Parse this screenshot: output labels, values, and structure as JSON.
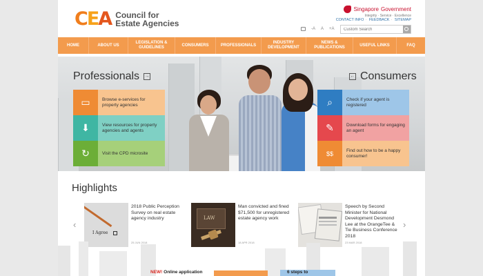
{
  "logo": {
    "mark": "CEA",
    "line1": "Council for",
    "line2": "Estate Agencies"
  },
  "gov": {
    "name_pre": "Singapore ",
    "name_post": "Government",
    "tagline": "Integrity · Service · Excellence"
  },
  "util_links": [
    "CONTACT INFO",
    "FEEDBACK",
    "SITEMAP"
  ],
  "text_size": [
    "-A",
    "A",
    "+A"
  ],
  "search": {
    "placeholder": "Custom Search"
  },
  "nav": [
    "HOME",
    "ABOUT US",
    "LEGISLATION & GUIDELINES",
    "CONSUMERS",
    "PROFESSIONALS",
    "INDUSTRY DEVELOPMENT",
    "NEWS & PUBLICATIONS",
    "USEFUL LINKS",
    "FAQ"
  ],
  "hero": {
    "professionals_title": "Professionals",
    "consumers_title": "Consumers",
    "professionals": [
      {
        "label": "Browse e-services for property agencies",
        "color": "#f8c48f",
        "icon_bg": "#ef8b34",
        "icon": "laptop-icon"
      },
      {
        "label": "View resources for property agencies and agents",
        "color": "#7fd0c4",
        "icon_bg": "#3fb6a3",
        "icon": "download-icon"
      },
      {
        "label": "Visit the CPD microsite",
        "color": "#a6d07a",
        "icon_bg": "#6cae37",
        "icon": "refresh-icon"
      }
    ],
    "consumers": [
      {
        "label": "Check if your agent is registered",
        "color": "#9ec6e8",
        "icon_bg": "#2f7dc2",
        "icon": "magnifier-icon"
      },
      {
        "label": "Download forms for engaging an agent",
        "color": "#f1a2a2",
        "icon_bg": "#e5484d",
        "icon": "form-icon"
      },
      {
        "label": "Find out how to be a happy consumer!",
        "color": "#f8c48f",
        "icon_bg": "#ef8b34",
        "icon": "handshake-icon"
      }
    ]
  },
  "highlights": {
    "title": "Highlights",
    "items": [
      {
        "title": "2018 Public Perception Survey on real estate agency industry",
        "date": "25 JUN 2018",
        "thumb_text": "I Agree"
      },
      {
        "title": "Man convicted and fined $71,500 for unregistered estate agency work",
        "date": "18 APR 2018",
        "thumb_text": "LAW"
      },
      {
        "title": "Speech by Second Minister for National Development Desmond Lee at the OrangeTee & Tie Business Conference 2018",
        "date": "23 MAR 2018",
        "thumb_text": ""
      }
    ]
  },
  "bottom": {
    "new_label": "NEW!",
    "online_label": "Online application",
    "steps_label": "6 steps to"
  }
}
